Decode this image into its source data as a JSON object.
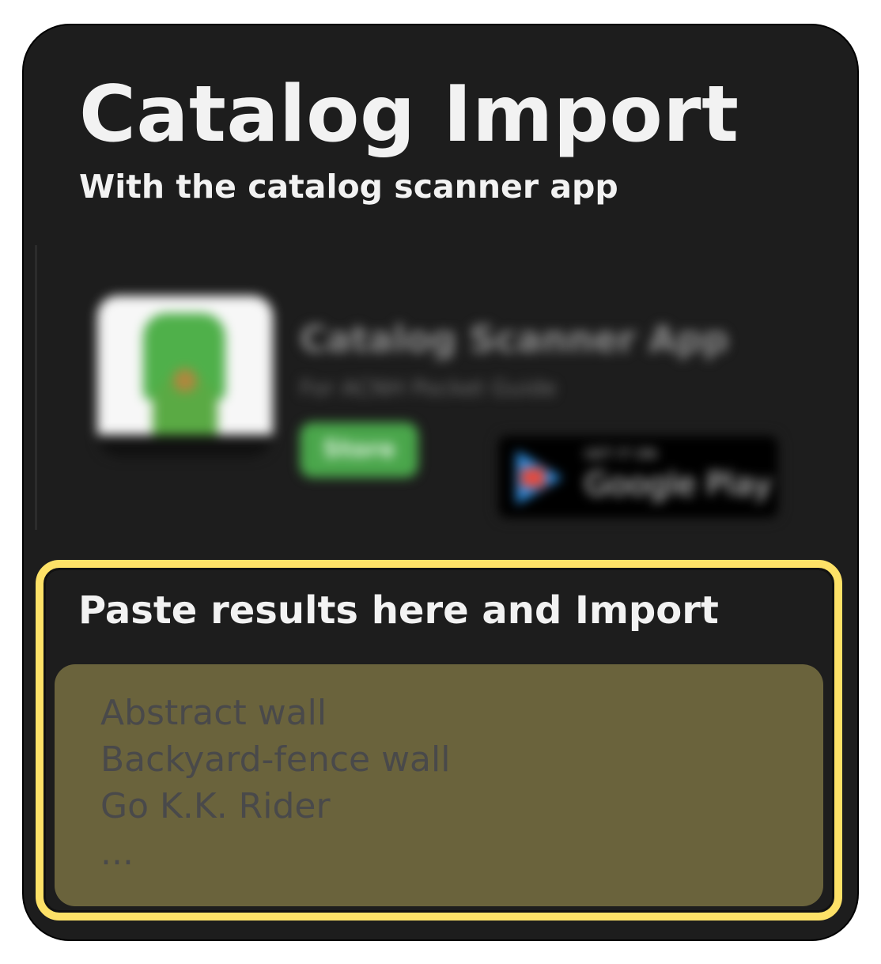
{
  "header": {
    "title": "Catalog Import",
    "subtitle": "With the catalog scanner app"
  },
  "app_promo": {
    "app_name": "Catalog Scanner App",
    "app_description": "For ACNH Pocket Guide",
    "store_button_label": "Store",
    "google_play": {
      "get_it_on": "GET IT ON",
      "store_name": "Google Play"
    }
  },
  "paste_section": {
    "label": "Paste results here and Import",
    "placeholder": "Abstract wall\nBackyard-fence wall\nGo K.K. Rider\n...",
    "value": "",
    "highlight_color": "#fde167",
    "textarea_color": "#6a633c"
  }
}
